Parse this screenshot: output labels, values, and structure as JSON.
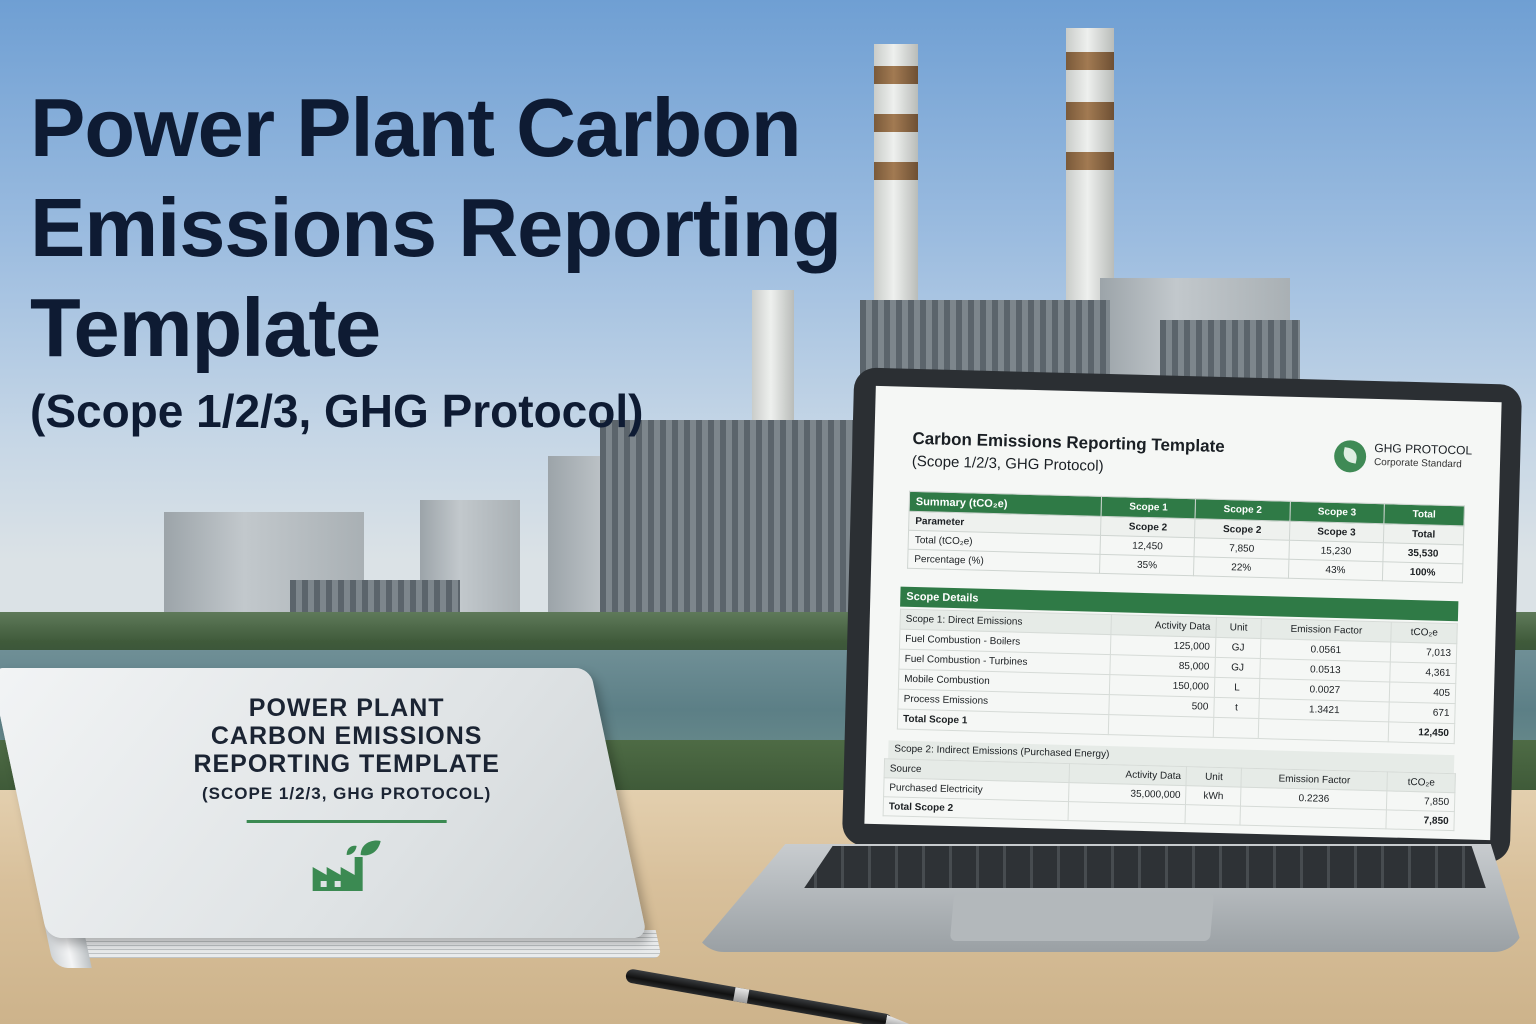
{
  "headline": {
    "line1": "Power Plant Carbon",
    "line2": "Emissions Reporting",
    "line3": "Template",
    "subtitle": "(Scope 1/2/3, GHG Protocol)"
  },
  "binder": {
    "title_line1": "POWER PLANT",
    "title_line2": "CARBON EMISSIONS",
    "title_line3": "REPORTING TEMPLATE",
    "subtitle": "(SCOPE 1/2/3, GHG PROTOCOL)",
    "icon": "factory-leaf-icon",
    "accent": "#3b8a52"
  },
  "screen": {
    "title": "Carbon Emissions Reporting Template",
    "subtitle": "(Scope 1/2/3, GHG Protocol)",
    "badge_name": "GHG PROTOCOL",
    "badge_standard": "Corporate Standard",
    "summary": {
      "header": [
        "Summary (tCO₂e)",
        "Scope 1",
        "Scope 2",
        "Scope 3",
        "Total"
      ],
      "subheader": [
        "Parameter",
        "Scope 2",
        "Scope 2",
        "Scope 3",
        "Total"
      ],
      "rows": [
        [
          "Total (tCO₂e)",
          "12,450",
          "7,850",
          "15,230",
          "35,530"
        ],
        [
          "Percentage (%)",
          "35%",
          "22%",
          "43%",
          "100%"
        ]
      ]
    },
    "details": {
      "section_title": "Scope Details",
      "scope1_header": [
        "Scope 1: Direct Emissions",
        "Activity Data",
        "Unit",
        "Emission Factor",
        "tCO₂e"
      ],
      "scope1_rows": [
        [
          "Fuel Combustion - Boilers",
          "125,000",
          "GJ",
          "0.0561",
          "7,013"
        ],
        [
          "Fuel Combustion - Turbines",
          "85,000",
          "GJ",
          "0.0513",
          "4,361"
        ],
        [
          "Mobile Combustion",
          "150,000",
          "L",
          "0.0027",
          "405"
        ],
        [
          "Process Emissions",
          "500",
          "t",
          "1.3421",
          "671"
        ]
      ],
      "scope1_total_label": "Total Scope 1",
      "scope1_total": "12,450",
      "scope2_title": "Scope 2: Indirect Emissions (Purchased Energy)",
      "scope2_header": [
        "Source",
        "Activity Data",
        "Unit",
        "Emission Factor",
        "tCO₂e"
      ],
      "scope2_rows": [
        [
          "Purchased Electricity",
          "35,000,000",
          "kWh",
          "0.2236",
          "7,850"
        ]
      ],
      "scope2_total_label": "Total Scope 2",
      "scope2_total": "7,850"
    },
    "accent": "#2f7a46"
  }
}
